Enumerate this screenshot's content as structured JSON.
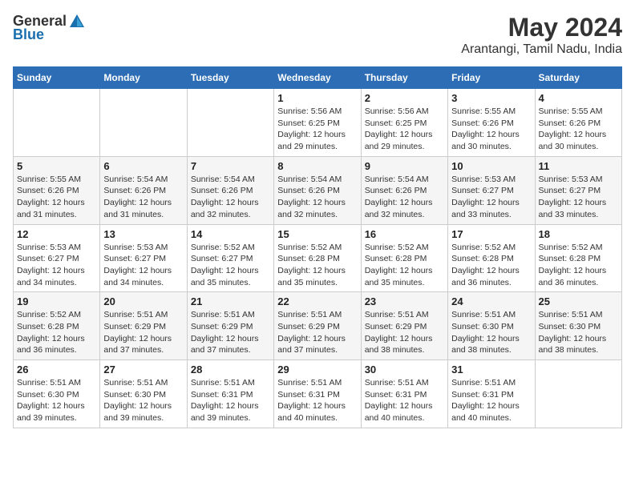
{
  "logo": {
    "general": "General",
    "blue": "Blue"
  },
  "title": {
    "month_year": "May 2024",
    "location": "Arantangi, Tamil Nadu, India"
  },
  "weekdays": [
    "Sunday",
    "Monday",
    "Tuesday",
    "Wednesday",
    "Thursday",
    "Friday",
    "Saturday"
  ],
  "weeks": [
    [
      {
        "day": "",
        "info": ""
      },
      {
        "day": "",
        "info": ""
      },
      {
        "day": "",
        "info": ""
      },
      {
        "day": "1",
        "info": "Sunrise: 5:56 AM\nSunset: 6:25 PM\nDaylight: 12 hours\nand 29 minutes."
      },
      {
        "day": "2",
        "info": "Sunrise: 5:56 AM\nSunset: 6:25 PM\nDaylight: 12 hours\nand 29 minutes."
      },
      {
        "day": "3",
        "info": "Sunrise: 5:55 AM\nSunset: 6:26 PM\nDaylight: 12 hours\nand 30 minutes."
      },
      {
        "day": "4",
        "info": "Sunrise: 5:55 AM\nSunset: 6:26 PM\nDaylight: 12 hours\nand 30 minutes."
      }
    ],
    [
      {
        "day": "5",
        "info": "Sunrise: 5:55 AM\nSunset: 6:26 PM\nDaylight: 12 hours\nand 31 minutes."
      },
      {
        "day": "6",
        "info": "Sunrise: 5:54 AM\nSunset: 6:26 PM\nDaylight: 12 hours\nand 31 minutes."
      },
      {
        "day": "7",
        "info": "Sunrise: 5:54 AM\nSunset: 6:26 PM\nDaylight: 12 hours\nand 32 minutes."
      },
      {
        "day": "8",
        "info": "Sunrise: 5:54 AM\nSunset: 6:26 PM\nDaylight: 12 hours\nand 32 minutes."
      },
      {
        "day": "9",
        "info": "Sunrise: 5:54 AM\nSunset: 6:26 PM\nDaylight: 12 hours\nand 32 minutes."
      },
      {
        "day": "10",
        "info": "Sunrise: 5:53 AM\nSunset: 6:27 PM\nDaylight: 12 hours\nand 33 minutes."
      },
      {
        "day": "11",
        "info": "Sunrise: 5:53 AM\nSunset: 6:27 PM\nDaylight: 12 hours\nand 33 minutes."
      }
    ],
    [
      {
        "day": "12",
        "info": "Sunrise: 5:53 AM\nSunset: 6:27 PM\nDaylight: 12 hours\nand 34 minutes."
      },
      {
        "day": "13",
        "info": "Sunrise: 5:53 AM\nSunset: 6:27 PM\nDaylight: 12 hours\nand 34 minutes."
      },
      {
        "day": "14",
        "info": "Sunrise: 5:52 AM\nSunset: 6:27 PM\nDaylight: 12 hours\nand 35 minutes."
      },
      {
        "day": "15",
        "info": "Sunrise: 5:52 AM\nSunset: 6:28 PM\nDaylight: 12 hours\nand 35 minutes."
      },
      {
        "day": "16",
        "info": "Sunrise: 5:52 AM\nSunset: 6:28 PM\nDaylight: 12 hours\nand 35 minutes."
      },
      {
        "day": "17",
        "info": "Sunrise: 5:52 AM\nSunset: 6:28 PM\nDaylight: 12 hours\nand 36 minutes."
      },
      {
        "day": "18",
        "info": "Sunrise: 5:52 AM\nSunset: 6:28 PM\nDaylight: 12 hours\nand 36 minutes."
      }
    ],
    [
      {
        "day": "19",
        "info": "Sunrise: 5:52 AM\nSunset: 6:28 PM\nDaylight: 12 hours\nand 36 minutes."
      },
      {
        "day": "20",
        "info": "Sunrise: 5:51 AM\nSunset: 6:29 PM\nDaylight: 12 hours\nand 37 minutes."
      },
      {
        "day": "21",
        "info": "Sunrise: 5:51 AM\nSunset: 6:29 PM\nDaylight: 12 hours\nand 37 minutes."
      },
      {
        "day": "22",
        "info": "Sunrise: 5:51 AM\nSunset: 6:29 PM\nDaylight: 12 hours\nand 37 minutes."
      },
      {
        "day": "23",
        "info": "Sunrise: 5:51 AM\nSunset: 6:29 PM\nDaylight: 12 hours\nand 38 minutes."
      },
      {
        "day": "24",
        "info": "Sunrise: 5:51 AM\nSunset: 6:30 PM\nDaylight: 12 hours\nand 38 minutes."
      },
      {
        "day": "25",
        "info": "Sunrise: 5:51 AM\nSunset: 6:30 PM\nDaylight: 12 hours\nand 38 minutes."
      }
    ],
    [
      {
        "day": "26",
        "info": "Sunrise: 5:51 AM\nSunset: 6:30 PM\nDaylight: 12 hours\nand 39 minutes."
      },
      {
        "day": "27",
        "info": "Sunrise: 5:51 AM\nSunset: 6:30 PM\nDaylight: 12 hours\nand 39 minutes."
      },
      {
        "day": "28",
        "info": "Sunrise: 5:51 AM\nSunset: 6:31 PM\nDaylight: 12 hours\nand 39 minutes."
      },
      {
        "day": "29",
        "info": "Sunrise: 5:51 AM\nSunset: 6:31 PM\nDaylight: 12 hours\nand 40 minutes."
      },
      {
        "day": "30",
        "info": "Sunrise: 5:51 AM\nSunset: 6:31 PM\nDaylight: 12 hours\nand 40 minutes."
      },
      {
        "day": "31",
        "info": "Sunrise: 5:51 AM\nSunset: 6:31 PM\nDaylight: 12 hours\nand 40 minutes."
      },
      {
        "day": "",
        "info": ""
      }
    ]
  ]
}
